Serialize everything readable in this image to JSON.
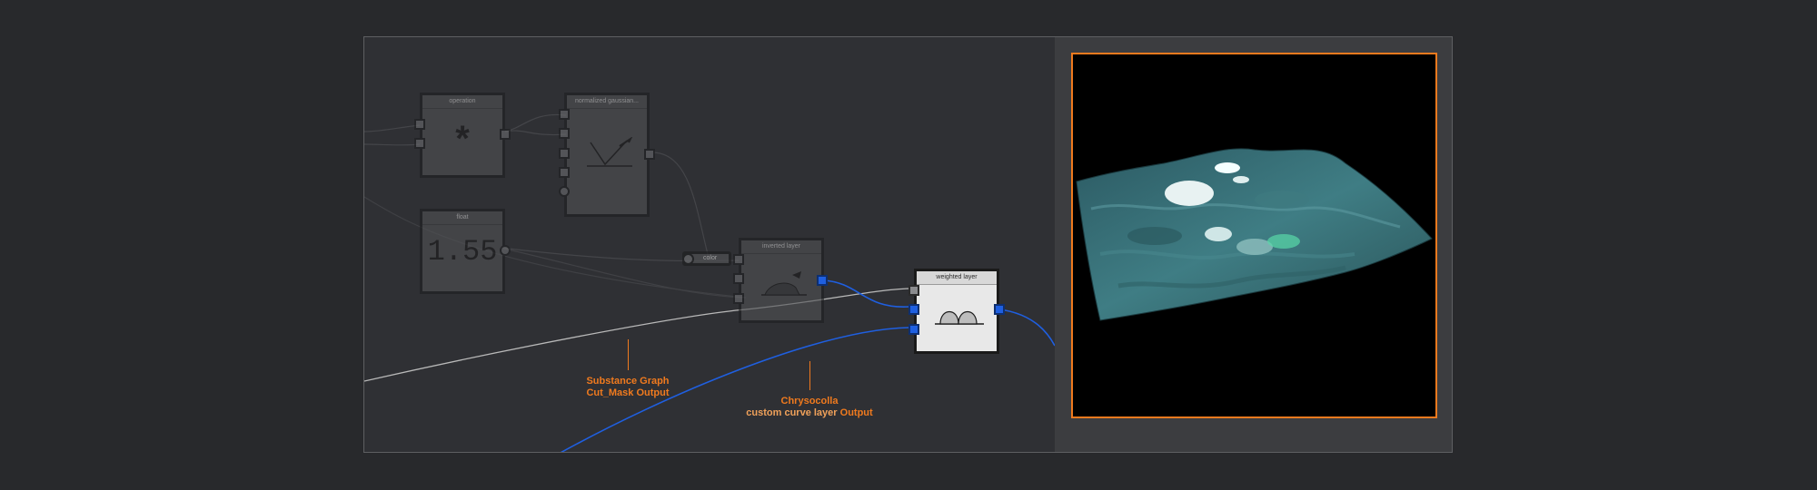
{
  "graph": {
    "nodes": {
      "operator": {
        "title": "operation",
        "symbol": "*"
      },
      "distribution": {
        "title": "normalized gaussian..."
      },
      "float": {
        "title": "float",
        "value": "1.55"
      },
      "curve_layer": {
        "title": "inverted layer"
      },
      "weighted_layer": {
        "title": "weighted layer"
      }
    },
    "chip": {
      "label": "color"
    },
    "annotations": [
      {
        "line1_white": "Substance Graph",
        "line2_white": "Cut_Mask",
        "line2_orange": "Output"
      },
      {
        "line1_white": "Chrysocolla",
        "line2_white": "custom curve layer",
        "line2_orange": "Output"
      }
    ]
  },
  "colors": {
    "accent_orange": "#f07a1e",
    "wire_blue": "#1f5fe0",
    "port_blue": "#1f5fe0",
    "background": "#28292c"
  },
  "preview": {
    "label": "3D terrain preview"
  }
}
